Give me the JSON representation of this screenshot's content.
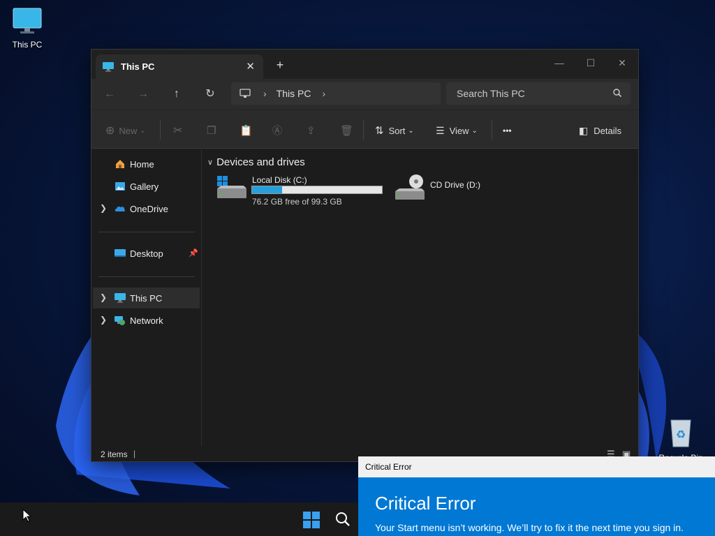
{
  "desktop": {
    "icons": [
      {
        "label": "This PC"
      },
      {
        "label": "Recycle Bin"
      }
    ]
  },
  "window": {
    "tab_title": "This PC",
    "new_tab_label": "+",
    "address": {
      "items": [
        "This PC"
      ]
    },
    "search_placeholder": "Search This PC",
    "toolbar": {
      "new_label": "New",
      "sort_label": "Sort",
      "view_label": "View",
      "more_label": "•••",
      "details_label": "Details"
    },
    "sidebar": {
      "items": [
        {
          "label": "Home"
        },
        {
          "label": "Gallery"
        },
        {
          "label": "OneDrive"
        },
        {
          "label": "Desktop"
        },
        {
          "label": "This PC"
        },
        {
          "label": "Network"
        }
      ]
    },
    "content": {
      "group_label": "Devices and drives",
      "drives": [
        {
          "name": "Local Disk (C:)",
          "free_text": "76.2 GB free of 99.3 GB",
          "used_fraction": 0.233
        },
        {
          "name": "CD Drive (D:)"
        }
      ]
    },
    "status": {
      "items_count": "2 items"
    }
  },
  "critical_error": {
    "window_title": "Critical Error",
    "heading": "Critical Error",
    "message": "Your Start menu isn’t working. We’ll try to fix it the next time you sign in."
  },
  "colors": {
    "accent": "#0078d4",
    "progress": "#26a0da"
  }
}
